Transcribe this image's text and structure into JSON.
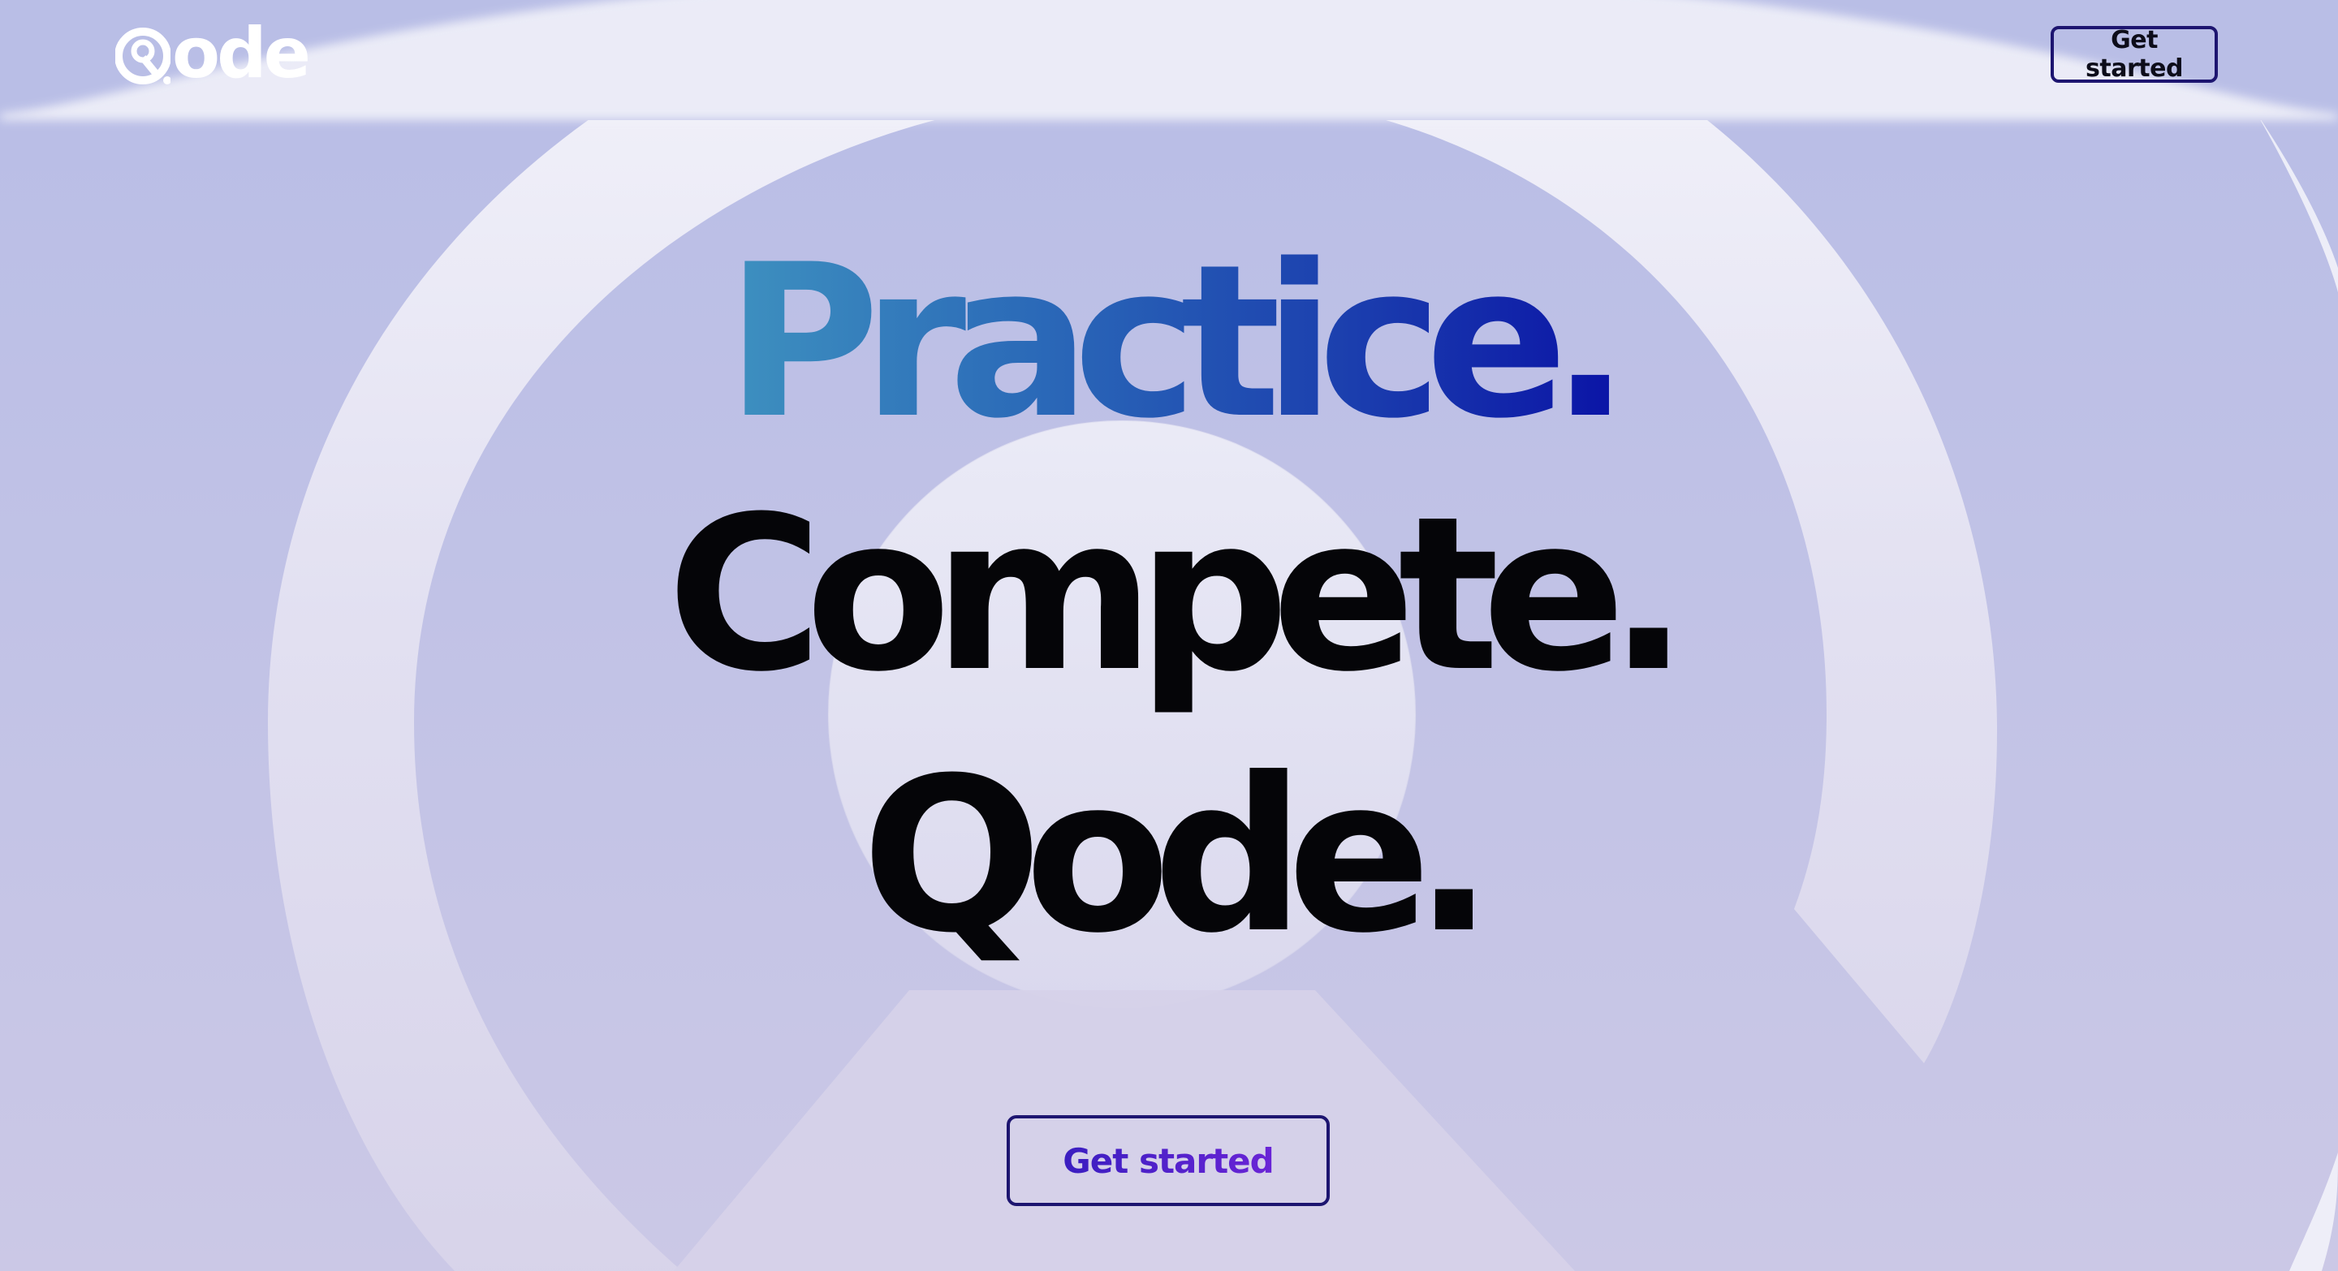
{
  "brand": {
    "logo_text": "ode",
    "logo_mark_icon": "q-logo-icon"
  },
  "header": {
    "cta_label": "Get started"
  },
  "hero": {
    "line1": "Practice.",
    "line2": "Compete.",
    "line3": "Qode.",
    "cta_label": "Get started"
  },
  "colors": {
    "background": "#b9bee6",
    "accent_border": "#1d1570",
    "gradient_start": "#3f93c0",
    "gradient_end": "#0a12a6",
    "cta_text_start": "#3a1ec0",
    "cta_text_end": "#6a24d6"
  }
}
